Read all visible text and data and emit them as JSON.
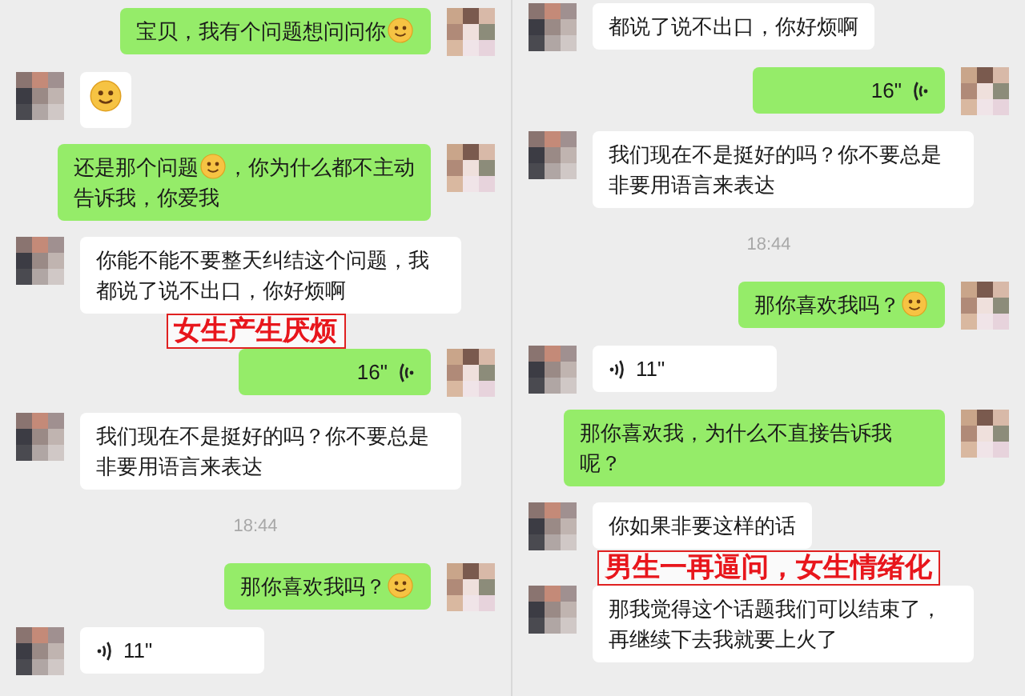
{
  "panels": [
    {
      "messages": [
        {
          "kind": "text",
          "outgoing": true,
          "segments": [
            {
              "kind": "text",
              "text": "宝贝，我有个问题想问问你"
            },
            {
              "kind": "emoji"
            }
          ]
        },
        {
          "kind": "sticker",
          "outgoing": false
        },
        {
          "kind": "text",
          "outgoing": true,
          "segments": [
            {
              "kind": "text",
              "text": "还是那个问题"
            },
            {
              "kind": "emoji"
            },
            {
              "kind": "text",
              "text": "，你为什么都不主动"
            },
            {
              "kind": "line",
              "text": "告诉我，你爱我"
            }
          ]
        },
        {
          "kind": "text",
          "outgoing": false,
          "segments": [
            {
              "kind": "text",
              "text": "你能不能不要整天纠结这个问题，我都说了说不出口，你好烦啊"
            }
          ]
        },
        {
          "kind": "note",
          "text": "女生产生厌烦"
        },
        {
          "kind": "voice",
          "outgoing": true,
          "duration": "16\""
        },
        {
          "kind": "text",
          "outgoing": false,
          "segments": [
            {
              "kind": "text",
              "text": "我们现在不是挺好的吗？你不要总是非要用语言来表达"
            }
          ]
        },
        {
          "kind": "time",
          "text": "18:44"
        },
        {
          "kind": "text",
          "outgoing": true,
          "segments": [
            {
              "kind": "text",
              "text": "那你喜欢我吗？"
            },
            {
              "kind": "emoji"
            }
          ]
        },
        {
          "kind": "voice",
          "outgoing": false,
          "duration": "11\""
        }
      ]
    },
    {
      "messages": [
        {
          "kind": "text",
          "outgoing": false,
          "segments": [
            {
              "kind": "text",
              "text": "都说了说不出口，你好烦啊"
            }
          ]
        },
        {
          "kind": "voice",
          "outgoing": true,
          "duration": "16\""
        },
        {
          "kind": "text",
          "outgoing": false,
          "segments": [
            {
              "kind": "text",
              "text": "我们现在不是挺好的吗？你不要总是非要用语言来表达"
            }
          ]
        },
        {
          "kind": "time",
          "text": "18:44"
        },
        {
          "kind": "text",
          "outgoing": true,
          "segments": [
            {
              "kind": "text",
              "text": "那你喜欢我吗？"
            },
            {
              "kind": "emoji"
            }
          ]
        },
        {
          "kind": "voice",
          "outgoing": false,
          "duration": "11\""
        },
        {
          "kind": "text",
          "outgoing": true,
          "segments": [
            {
              "kind": "text",
              "text": "那你喜欢我，为什么不直接告诉我呢？"
            }
          ]
        },
        {
          "kind": "text",
          "outgoing": false,
          "segments": [
            {
              "kind": "text",
              "text": "你如果非要这样的话"
            }
          ]
        },
        {
          "kind": "note",
          "text": "男生一再逼问，女生情绪化"
        },
        {
          "kind": "text",
          "outgoing": false,
          "segments": [
            {
              "kind": "text",
              "text": "那我觉得这个话题我们可以结束了，再继续下去我就要上火了"
            }
          ]
        }
      ]
    }
  ]
}
